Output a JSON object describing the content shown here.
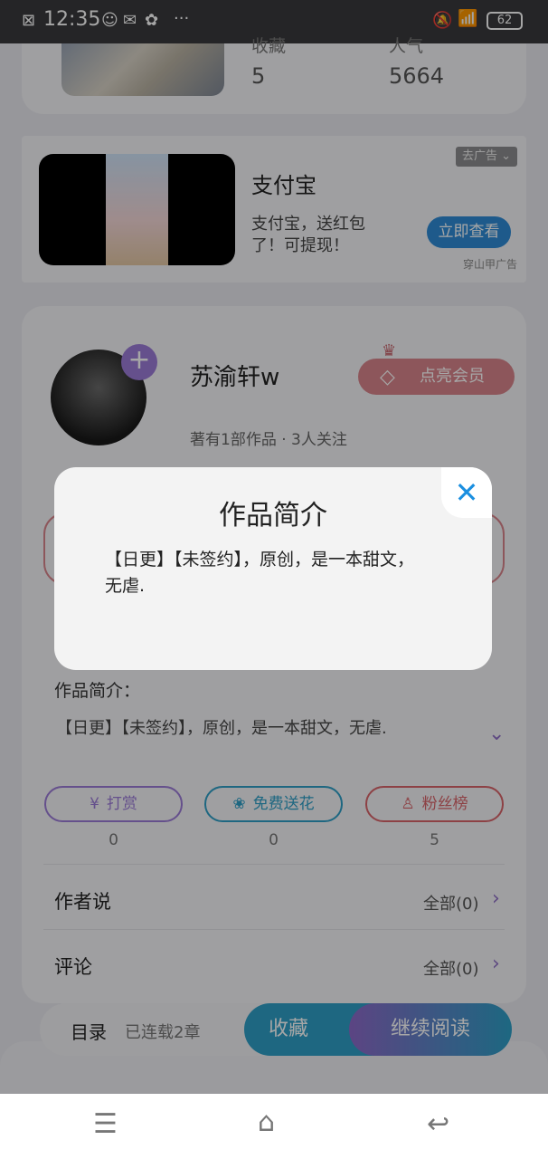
{
  "status_bar": {
    "time": "12:35",
    "battery": "62",
    "more": "···"
  },
  "book": {
    "stats": [
      {
        "label": "收藏",
        "value": "5"
      },
      {
        "label": "人气",
        "value": "5664"
      }
    ]
  },
  "ad": {
    "title": "支付宝",
    "description": "支付宝，送红包了！可提现！",
    "cta": "立即查看",
    "tag": "去广告",
    "source": "穿山甲广告"
  },
  "author": {
    "name": "苏渝轩w",
    "meta": "著有1部作品 · 3人关注",
    "vip_label": "点亮会员"
  },
  "intro": {
    "title": "作品简介：",
    "text": "【日更】【未签约】，原创，是一本甜文，无虐."
  },
  "actions": [
    {
      "label": "打赏",
      "count": "0",
      "icon": "yen-icon",
      "color": "#9c7bd8"
    },
    {
      "label": "免费送花",
      "count": "0",
      "icon": "flower-icon",
      "color": "#2e9fc7"
    },
    {
      "label": "粉丝榜",
      "count": "5",
      "icon": "user-icon",
      "color": "#d9646a"
    }
  ],
  "rows": [
    {
      "title": "作者说",
      "right": "全部(0)"
    },
    {
      "title": "评论",
      "right": "全部(0)"
    }
  ],
  "bottom_bar": {
    "toc": "目录",
    "serial": "已连载2章",
    "collect": "收藏",
    "read": "继续阅读"
  },
  "modal": {
    "title": "作品简介",
    "text": "【日更】【未签约】，原创，是一本甜文，无虐."
  },
  "colors": {
    "accent_blue": "#2e9fc7",
    "accent_purple": "#9c7bd8",
    "close_blue": "#1b8fe0"
  }
}
